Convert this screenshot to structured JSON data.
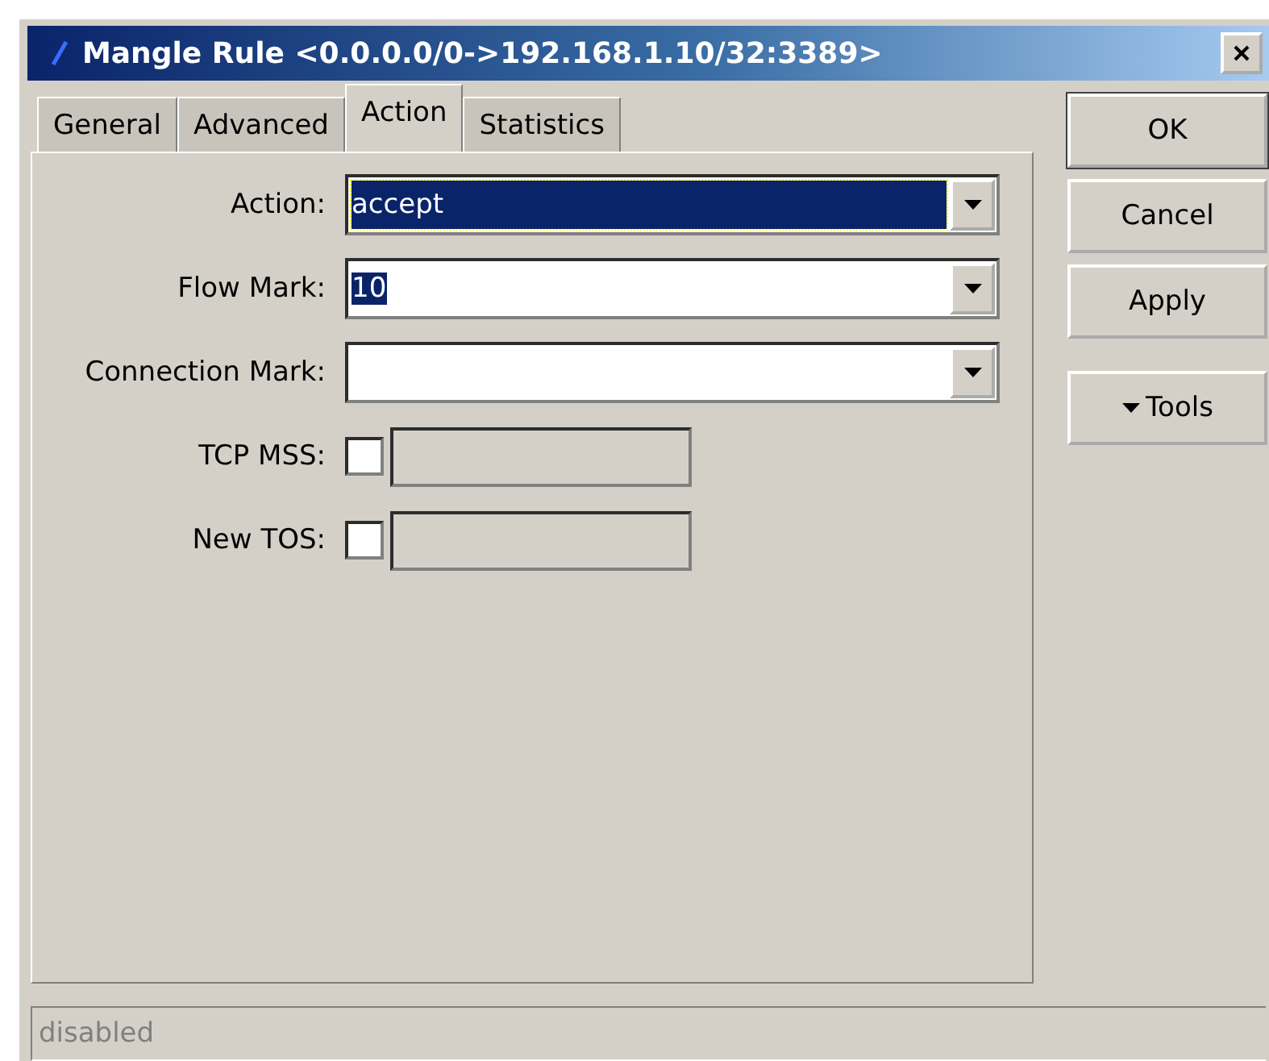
{
  "window": {
    "title": "Mangle Rule <0.0.0.0/0->192.168.1.10/32:3389>"
  },
  "tabs": [
    {
      "label": "General",
      "selected": false
    },
    {
      "label": "Advanced",
      "selected": false
    },
    {
      "label": "Action",
      "selected": true
    },
    {
      "label": "Statistics",
      "selected": false
    }
  ],
  "fields": [
    {
      "kind": "dropdown",
      "label": "Action:",
      "value": "accept",
      "focused": true
    },
    {
      "kind": "dropdown",
      "label": "Flow Mark:",
      "value": "10",
      "focused": false,
      "text_selected": true
    },
    {
      "kind": "dropdown",
      "label": "Connection Mark:",
      "focused": false
    },
    {
      "kind": "checkbox",
      "label": "TCP MSS:",
      "checked": false
    },
    {
      "kind": "checkbox",
      "label": "New TOS:",
      "checked": false
    }
  ],
  "buttons": [
    {
      "label": "OK",
      "kind": "default"
    },
    {
      "label": "Cancel",
      "kind": "plain"
    },
    {
      "label": "Apply",
      "kind": "plain"
    },
    {
      "label": "Tools",
      "kind": "menu"
    }
  ],
  "status_bar": "disabled"
}
